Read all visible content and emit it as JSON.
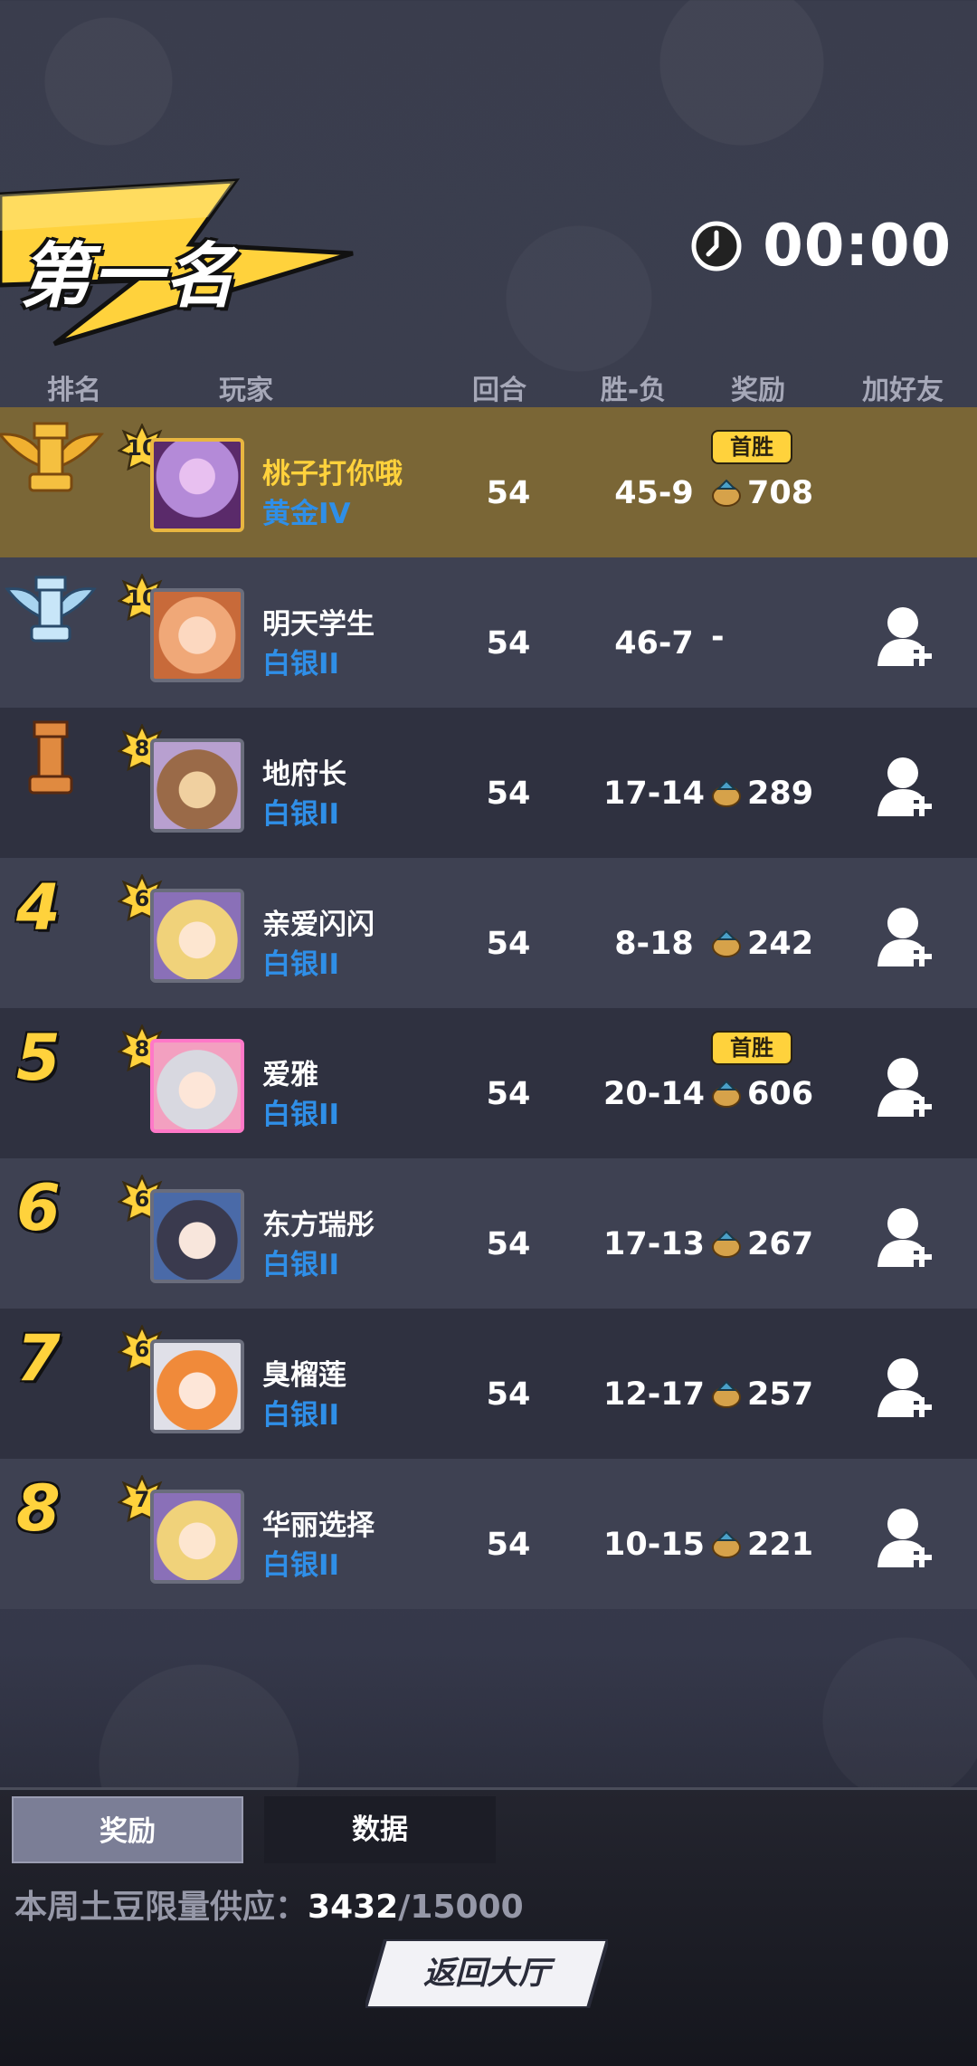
{
  "header": {
    "place_title": "第一名",
    "timer": "00:00"
  },
  "columns": [
    "排名",
    "玩家",
    "回合",
    "胜-负",
    "奖励",
    "加好友"
  ],
  "first_win_label": "首胜",
  "players": [
    {
      "rank": "1",
      "name": "桃子打你哦",
      "tier": "黄金IV",
      "level": "10",
      "rounds": "54",
      "wl": "45-9",
      "reward": "708",
      "first_win": true,
      "self": true,
      "avatar_color": "#b48ad8"
    },
    {
      "rank": "2",
      "name": "明天学生",
      "tier": "白银II",
      "level": "10",
      "rounds": "54",
      "wl": "46-7",
      "reward": "-",
      "first_win": false,
      "self": false,
      "avatar_color": "#f0a878"
    },
    {
      "rank": "3",
      "name": "地府长",
      "tier": "白银II",
      "level": "8",
      "rounds": "54",
      "wl": "17-14",
      "reward": "289",
      "first_win": false,
      "self": false,
      "avatar_color": "#9a6a48"
    },
    {
      "rank": "4",
      "name": "亲爱闪闪",
      "tier": "白银II",
      "level": "6",
      "rounds": "54",
      "wl": "8-18",
      "reward": "242",
      "first_win": false,
      "self": false,
      "avatar_color": "#f0d27a"
    },
    {
      "rank": "5",
      "name": "爱雅",
      "tier": "白银II",
      "level": "8",
      "rounds": "54",
      "wl": "20-14",
      "reward": "606",
      "first_win": true,
      "self": false,
      "avatar_color": "#d8d8e0"
    },
    {
      "rank": "6",
      "name": "东方瑞彤",
      "tier": "白银II",
      "level": "6",
      "rounds": "54",
      "wl": "17-13",
      "reward": "267",
      "first_win": false,
      "self": false,
      "avatar_color": "#3a3a4e"
    },
    {
      "rank": "7",
      "name": "臭榴莲",
      "tier": "白银II",
      "level": "6",
      "rounds": "54",
      "wl": "12-17",
      "reward": "257",
      "first_win": false,
      "self": false,
      "avatar_color": "#f08a3a"
    },
    {
      "rank": "8",
      "name": "华丽选择",
      "tier": "白银II",
      "level": "7",
      "rounds": "54",
      "wl": "10-15",
      "reward": "221",
      "first_win": false,
      "self": false,
      "avatar_color": "#f0d27a"
    }
  ],
  "bottom": {
    "tabs": [
      "奖励",
      "数据"
    ],
    "supply_label": "本周土豆限量供应：",
    "supply_current": "3432",
    "supply_max": "/15000",
    "return_label": "返回大厅"
  },
  "colors": {
    "gold_row": "#7a6636",
    "accent_yellow": "#ffd23c",
    "tier_blue": "#2f8fe8"
  }
}
